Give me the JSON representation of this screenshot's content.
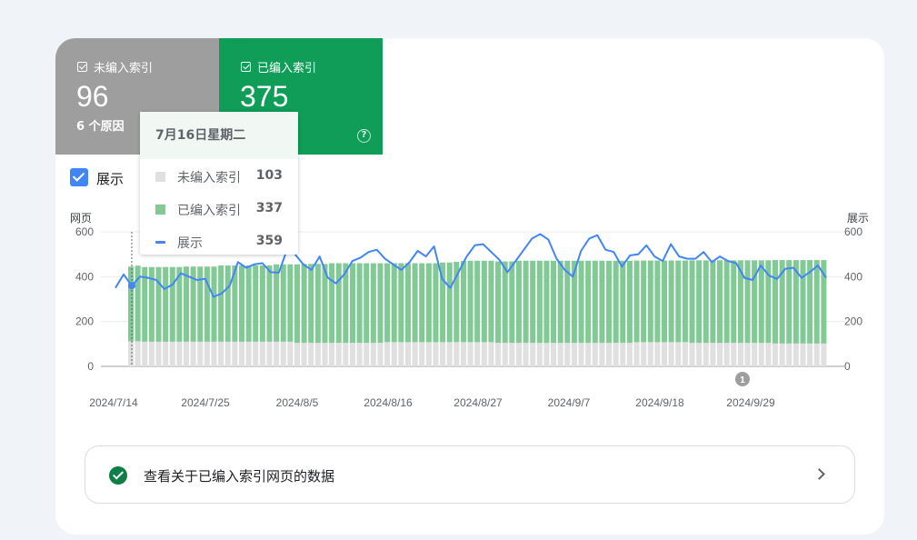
{
  "tiles": {
    "nonindexed": {
      "label": "未编入索引",
      "value": "96",
      "subtitle": "6 个原因",
      "color": "#9e9e9e"
    },
    "indexed": {
      "label": "已编入索引",
      "value": "375",
      "help_icon": "help-circle-icon",
      "color": "#0f9d58"
    }
  },
  "show_toggle": {
    "label": "展示",
    "checked": true,
    "color": "#4285f4"
  },
  "axis": {
    "left_title": "网页",
    "right_title": "展示"
  },
  "tooltip": {
    "date": "7月16日星期二",
    "rows": [
      {
        "label": "未编入索引",
        "value": "103",
        "color": "#e0e0e0"
      },
      {
        "label": "已编入索引",
        "value": "337",
        "color": "#81c995"
      },
      {
        "label": "展示",
        "value": "359",
        "color": "#4285f4"
      }
    ]
  },
  "annotation": {
    "label": "1"
  },
  "bottom_link": {
    "text": "查看关于已编入索引网页的数据",
    "icon": "check-circle-icon",
    "chevron": "chevron-right-icon"
  },
  "chart_data": {
    "type": "bar",
    "x_tick_labels": [
      "2024/7/14",
      "2024/7/25",
      "2024/8/5",
      "2024/8/16",
      "2024/8/27",
      "2024/9/7",
      "2024/9/18",
      "2024/9/29"
    ],
    "y_left": {
      "ticks": [
        "600",
        "400",
        "200",
        "0"
      ],
      "range": [
        0,
        600
      ]
    },
    "y_right": {
      "ticks": [
        "600",
        "400",
        "200",
        "0"
      ],
      "range": [
        0,
        600
      ]
    },
    "series": [
      {
        "name": "未编入索引",
        "type": "bar-stacked",
        "color": "#e0e0e0",
        "values": [
          112,
          112,
          110,
          110,
          110,
          110,
          110,
          110,
          110,
          110,
          110,
          110,
          110,
          110,
          110,
          110,
          110,
          110,
          110,
          110,
          110,
          110,
          110,
          110,
          105,
          105,
          105,
          105,
          105,
          105,
          105,
          105,
          105,
          105,
          105,
          105,
          105,
          108,
          108,
          108,
          108,
          108,
          108,
          108,
          108,
          108,
          108,
          108,
          108,
          108,
          108,
          108,
          108,
          105,
          105,
          105,
          105,
          105,
          105,
          105,
          105,
          105,
          105,
          105,
          105,
          105,
          105,
          105,
          105,
          105,
          105,
          105,
          105,
          108,
          108,
          108,
          108,
          108,
          108,
          108,
          108,
          105,
          105,
          105,
          105,
          105,
          105,
          105,
          105,
          105,
          105,
          105,
          105,
          102,
          102,
          102,
          102,
          102,
          102,
          102,
          102
        ]
      },
      {
        "name": "已编入索引",
        "type": "bar-stacked",
        "color": "#81c995",
        "values": [
          333,
          337,
          333,
          333,
          333,
          333,
          333,
          333,
          335,
          335,
          335,
          335,
          335,
          340,
          340,
          340,
          340,
          340,
          340,
          340,
          340,
          345,
          345,
          345,
          350,
          352,
          352,
          352,
          352,
          355,
          355,
          355,
          355,
          355,
          355,
          355,
          355,
          352,
          352,
          352,
          352,
          352,
          352,
          352,
          352,
          355,
          355,
          358,
          362,
          363,
          363,
          363,
          363,
          363,
          363,
          363,
          366,
          366,
          366,
          366,
          366,
          366,
          366,
          366,
          366,
          366,
          366,
          366,
          366,
          366,
          366,
          366,
          366,
          364,
          364,
          364,
          364,
          364,
          364,
          364,
          364,
          368,
          368,
          368,
          368,
          368,
          368,
          368,
          368,
          368,
          368,
          368,
          368,
          372,
          372,
          372,
          372,
          372,
          372,
          372,
          372
        ]
      },
      {
        "name": "展示",
        "type": "line",
        "color": "#4285f4",
        "values": [
          350,
          410,
          360,
          400,
          395,
          385,
          345,
          365,
          415,
          400,
          385,
          390,
          310,
          325,
          360,
          465,
          440,
          455,
          460,
          420,
          418,
          520,
          500,
          455,
          430,
          490,
          395,
          370,
          410,
          470,
          485,
          510,
          520,
          480,
          455,
          430,
          465,
          515,
          490,
          535,
          390,
          350,
          420,
          490,
          540,
          545,
          510,
          475,
          420,
          470,
          520,
          570,
          590,
          565,
          480,
          430,
          400,
          515,
          570,
          585,
          520,
          510,
          445,
          495,
          500,
          540,
          490,
          470,
          545,
          490,
          480,
          480,
          510,
          465,
          490,
          470,
          460,
          395,
          385,
          450,
          405,
          390,
          435,
          440,
          395,
          420,
          450,
          395
        ]
      }
    ]
  }
}
